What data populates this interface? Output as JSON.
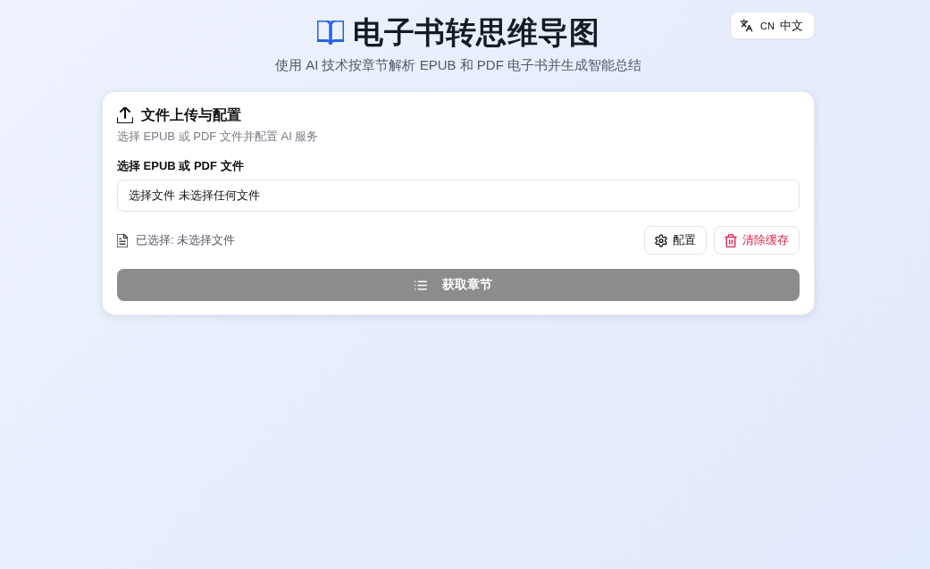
{
  "header": {
    "title": "电子书转思维导图",
    "subtitle": "使用 AI 技术按章节解析 EPUB 和 PDF 电子书并生成智能总结",
    "language_button": {
      "code": "CN",
      "label": "中文"
    }
  },
  "upload_card": {
    "title": "文件上传与配置",
    "description": "选择 EPUB 或 PDF 文件并配置 AI 服务",
    "file_field": {
      "label": "选择 EPUB 或 PDF 文件",
      "button": "选择文件",
      "value": "未选择任何文件"
    },
    "selected_file": "已选择: 未选择文件",
    "actions": [
      {
        "label": "配置",
        "kind": "settings"
      },
      {
        "label": "清除缓存",
        "kind": "danger"
      }
    ],
    "submit_button": {
      "label": "获取章节",
      "disabled": true
    }
  }
}
